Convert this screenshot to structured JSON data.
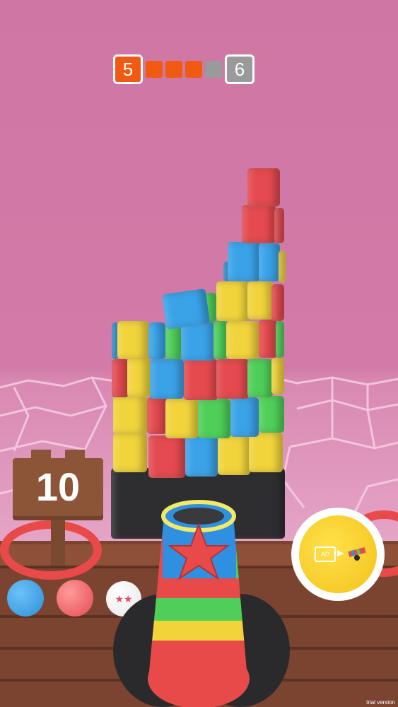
{
  "level_progress": {
    "current_level": "5",
    "next_level": "6",
    "segments_total": 4,
    "segments_filled": 3,
    "colors": {
      "current": "#f05a12",
      "filled": "#f05a12",
      "empty": "#9a9a9a"
    }
  },
  "shots_sign": {
    "value": "10"
  },
  "ammo_queue": [
    {
      "icon": "blue-ball-icon",
      "color": "#3aa3e8"
    },
    {
      "icon": "red-ball-icon",
      "color": "#e34b52"
    },
    {
      "icon": "star-ball-icon",
      "label": "★★"
    }
  ],
  "booster": {
    "ad_label": "AD",
    "arrow": "▶",
    "icon": "cannon-upgrade-icon"
  },
  "watermark": "trial version"
}
